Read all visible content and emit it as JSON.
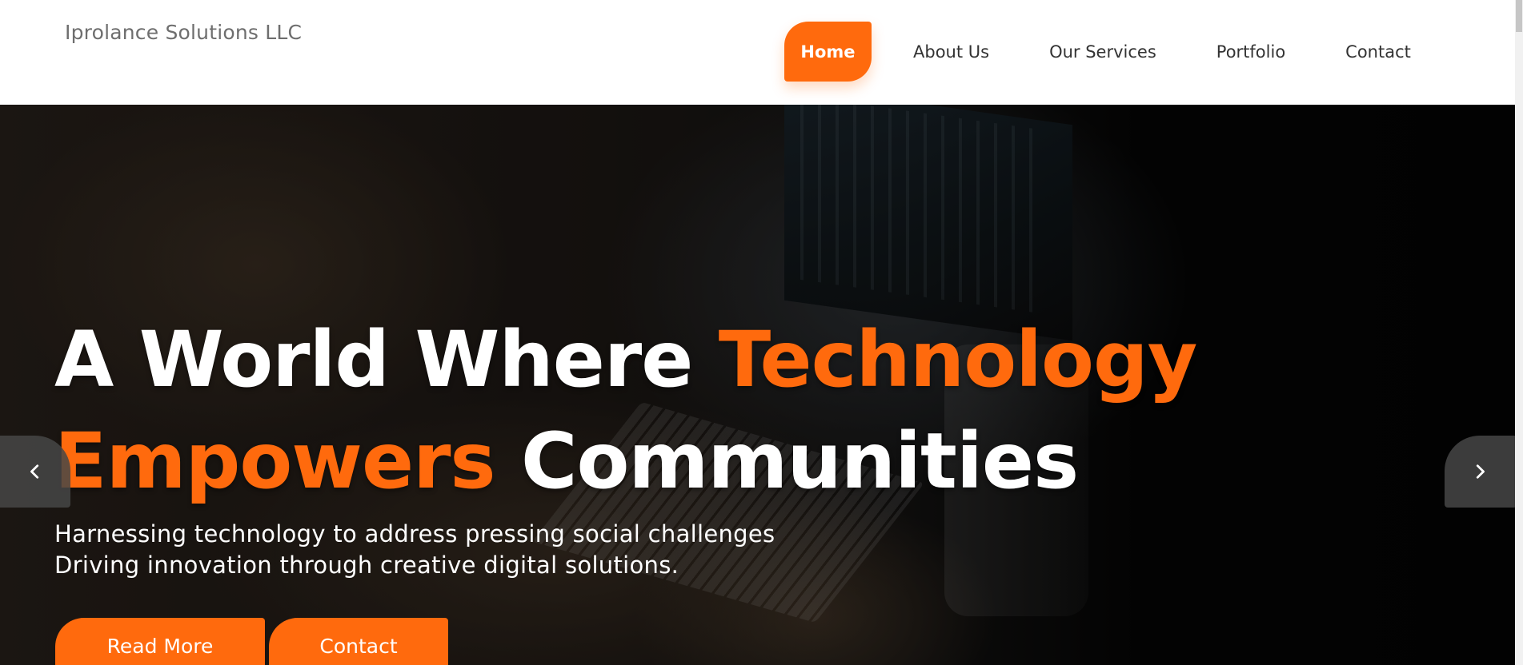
{
  "header": {
    "brand": "Iprolance Solutions LLC",
    "nav": [
      {
        "label": "Home",
        "active": true
      },
      {
        "label": "About Us",
        "active": false
      },
      {
        "label": "Our Services",
        "active": false
      },
      {
        "label": "Portfolio",
        "active": false
      },
      {
        "label": "Contact",
        "active": false
      }
    ]
  },
  "hero": {
    "headline_line1_white": "A World Where",
    "headline_line1_accent": "Technology",
    "headline_line2_accent": "Empowers",
    "headline_line2_white": "Communities",
    "subline_1": "Harnessing technology to address pressing social challenges",
    "subline_2": "Driving innovation through creative digital solutions.",
    "buttons": {
      "read_more": "Read More",
      "contact": "Contact"
    },
    "prev_icon": "chevron-left-icon",
    "next_icon": "chevron-right-icon"
  },
  "colors": {
    "accent": "#ff6a0d",
    "text_dark": "#333333",
    "brand_gray": "#6e6e6e",
    "arrow_bg": "#464646"
  }
}
